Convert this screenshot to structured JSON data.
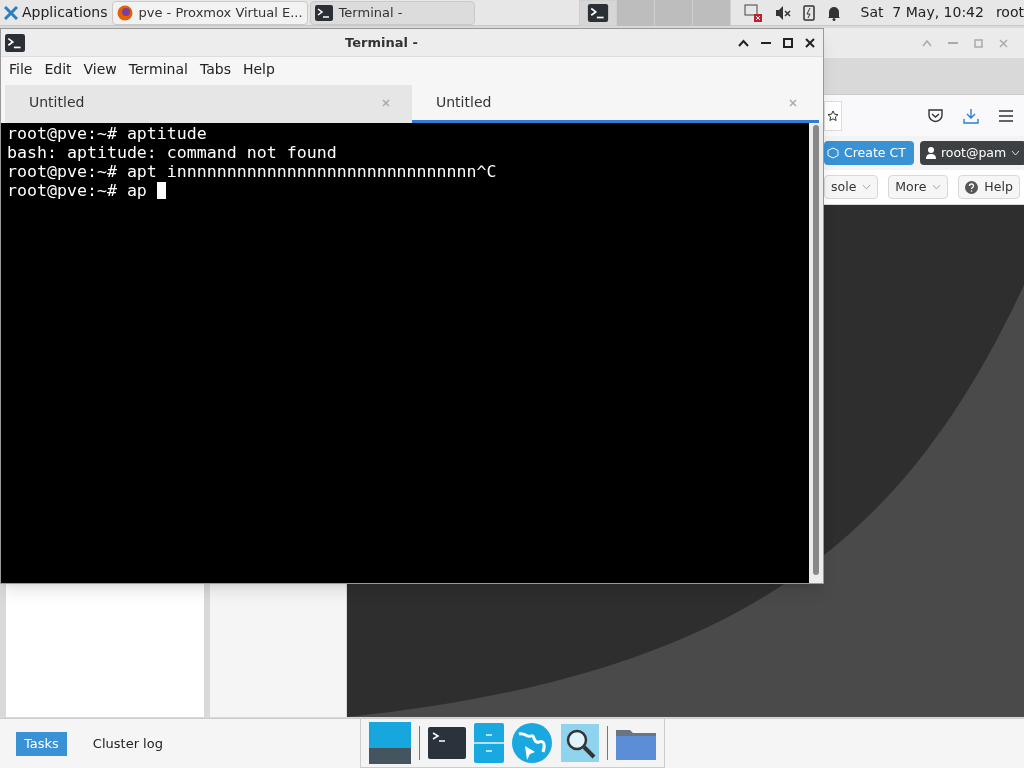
{
  "panel": {
    "applications": "Applications",
    "tasks": [
      {
        "title": "pve - Proxmox Virtual E...",
        "kind": "browser",
        "selected": false
      },
      {
        "title": "Terminal -",
        "kind": "terminal",
        "selected": true
      }
    ],
    "workspaces": [
      {
        "selected": true
      },
      {
        "selected": false
      },
      {
        "selected": false
      },
      {
        "selected": false
      }
    ],
    "clock": "Sat  7 May, 10:42",
    "user": "root"
  },
  "browser": {
    "create_button": "Create CT",
    "user_menu": "root@pam",
    "toolbar": [
      {
        "label": "sole",
        "kind": "split"
      },
      {
        "label": "More",
        "kind": "split"
      },
      {
        "label": "Help",
        "kind": "help"
      }
    ],
    "bottom_tabs": [
      {
        "label": "Tasks",
        "selected": true
      },
      {
        "label": "Cluster log",
        "selected": false
      }
    ]
  },
  "terminal": {
    "title": "Terminal -",
    "menu": [
      "File",
      "Edit",
      "View",
      "Terminal",
      "Tabs",
      "Help"
    ],
    "tabs": [
      {
        "label": "Untitled",
        "selected": false
      },
      {
        "label": "Untitled",
        "selected": true
      }
    ],
    "lines": [
      "root@pve:~# aptitude",
      "bash: aptitude: command not found",
      "root@pve:~# apt innnnnnnnnnnnnnnnnnnnnnnnnnnnnn^C",
      "root@pve:~# ap "
    ]
  },
  "dock": [
    {
      "kind": "desktop"
    },
    {
      "kind": "terminal"
    },
    {
      "kind": "files"
    },
    {
      "kind": "web"
    },
    {
      "kind": "search"
    },
    {
      "kind": "folder"
    }
  ]
}
